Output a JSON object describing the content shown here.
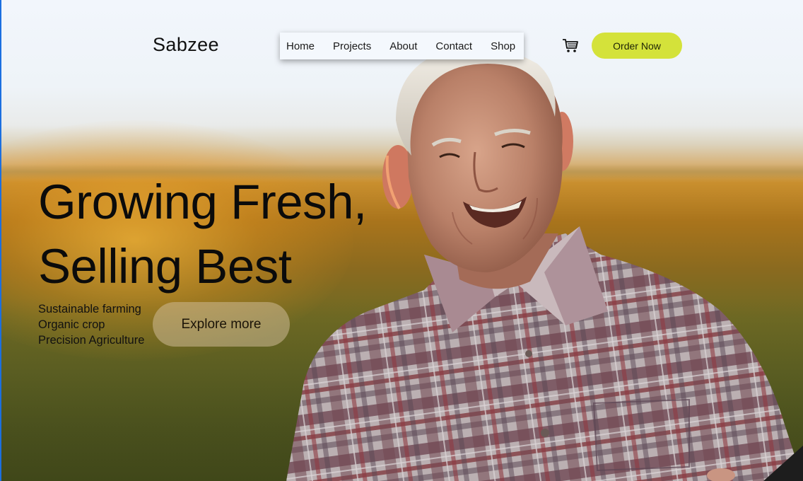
{
  "header": {
    "logo": "Sabzee",
    "nav": [
      "Home",
      "Projects",
      "About",
      "Contact",
      "Shop"
    ],
    "cart_icon": "shopping-cart-icon",
    "order_button": "Order Now"
  },
  "hero": {
    "headline_line1": "Growing Fresh,",
    "headline_line2": "Selling Best",
    "features": [
      "Sustainable farming",
      "Organic crop",
      "Precision Agriculture"
    ],
    "explore_button": "Explore more"
  },
  "colors": {
    "accent": "#d4e23a",
    "nav_bg": "#f4f8fd",
    "text": "#0b0b0b"
  }
}
